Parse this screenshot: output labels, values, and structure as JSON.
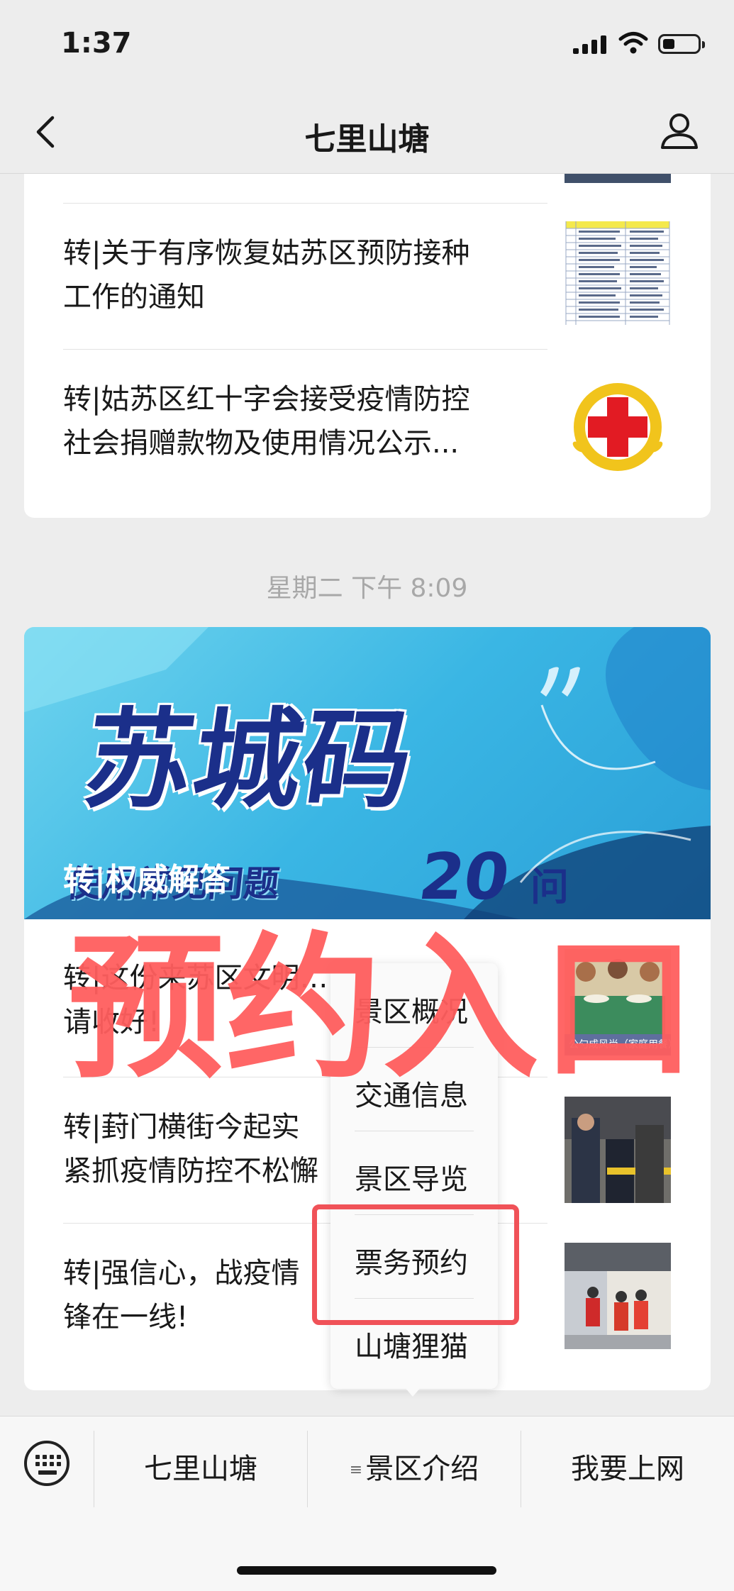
{
  "status_bar": {
    "time": "1:37"
  },
  "nav": {
    "title": "七里山塘"
  },
  "articles_top": [
    {
      "title_line1": "转|关于有序恢复姑苏区预防接种",
      "title_line2": "工作的通知"
    },
    {
      "title_line1": "转|姑苏区红十字会接受疫情防控",
      "title_line2": "社会捐赠款物及使用情况公示..."
    }
  ],
  "timestamp": "星期二 下午 8:09",
  "banner": {
    "heading": "苏城码",
    "subheading": "使用常见问题",
    "number": "20",
    "suffix": "问",
    "caption": "转|权威解答"
  },
  "articles_bottom": [
    {
      "title_line1": "转|这份来苏区文明…",
      "title_line2": "请收好!",
      "thumb_caption": "公勺成风尚（家庭用餐）"
    },
    {
      "title_line1": "转|葑门横街今起实",
      "title_line2": "紧抓疫情防控不松懈"
    },
    {
      "title_line1": "转|强信心，战疫情",
      "title_line2": "锋在一线!"
    }
  ],
  "popup_menu": {
    "items": [
      "景区概况",
      "交通信息",
      "景区导览",
      "票务预约",
      "山塘狸猫"
    ]
  },
  "overlay_annotation": "预约入口",
  "bottom_menu": {
    "tabs": [
      "七里山塘",
      "景区介绍",
      "我要上网"
    ]
  },
  "colors": {
    "annotation_red": "#f05258",
    "banner_blue": "#3ab6e4",
    "background": "#ededed"
  }
}
